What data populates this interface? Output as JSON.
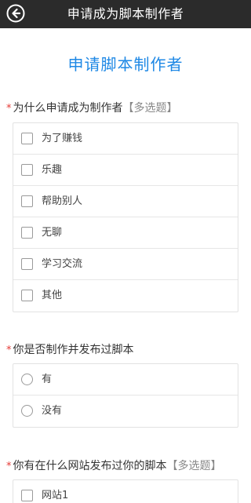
{
  "header": {
    "title": "申请成为脚本制作者",
    "back_icon": "back-arrow-icon"
  },
  "form": {
    "title": "申请脚本制作者",
    "required_mark": "*",
    "questions": [
      {
        "label": "为什么申请成为制作者",
        "hint": "【多选题】",
        "type": "checkbox",
        "options": [
          "为了赚钱",
          "乐趣",
          "帮助别人",
          "无聊",
          "学习交流",
          "其他"
        ]
      },
      {
        "label": "你是否制作并发布过脚本",
        "hint": "",
        "type": "radio",
        "options": [
          "有",
          "没有"
        ]
      },
      {
        "label": "你有在什么网站发布过你的脚本",
        "hint": "【多选题】",
        "type": "checkbox",
        "options": [
          "网站1"
        ]
      }
    ]
  },
  "colors": {
    "topbar": "#2b2b2b",
    "accent": "#1e88e5",
    "required": "#e53935"
  }
}
